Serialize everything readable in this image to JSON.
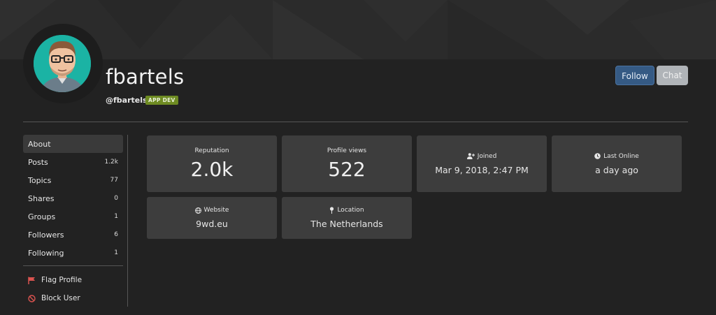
{
  "profile": {
    "username": "fbartels",
    "handle": "@fbartels",
    "badge": "APP DEV"
  },
  "actions": {
    "follow_label": "Follow",
    "chat_label": "Chat"
  },
  "sidebar": {
    "items": [
      {
        "label": "About",
        "count": ""
      },
      {
        "label": "Posts",
        "count": "1.2k"
      },
      {
        "label": "Topics",
        "count": "77"
      },
      {
        "label": "Shares",
        "count": "0"
      },
      {
        "label": "Groups",
        "count": "1"
      },
      {
        "label": "Followers",
        "count": "6"
      },
      {
        "label": "Following",
        "count": "1"
      }
    ],
    "flag_label": "Flag Profile",
    "block_label": "Block User"
  },
  "stats": {
    "reputation": {
      "label": "Reputation",
      "value": "2.0k"
    },
    "profile_views": {
      "label": "Profile views",
      "value": "522"
    },
    "joined": {
      "label": "Joined",
      "value": "Mar 9, 2018, 2:47 PM"
    },
    "last_online": {
      "label": "Last Online",
      "value": "a day ago"
    },
    "website": {
      "label": "Website",
      "value": "9wd.eu"
    },
    "location": {
      "label": "Location",
      "value": "The Netherlands"
    }
  },
  "colors": {
    "background": "#222222",
    "card": "#3d3d3d",
    "follow_button": "#355a84",
    "chat_button": "#b0b4b8",
    "badge": "#6e8b22",
    "flag_icon": "#d9534f"
  }
}
